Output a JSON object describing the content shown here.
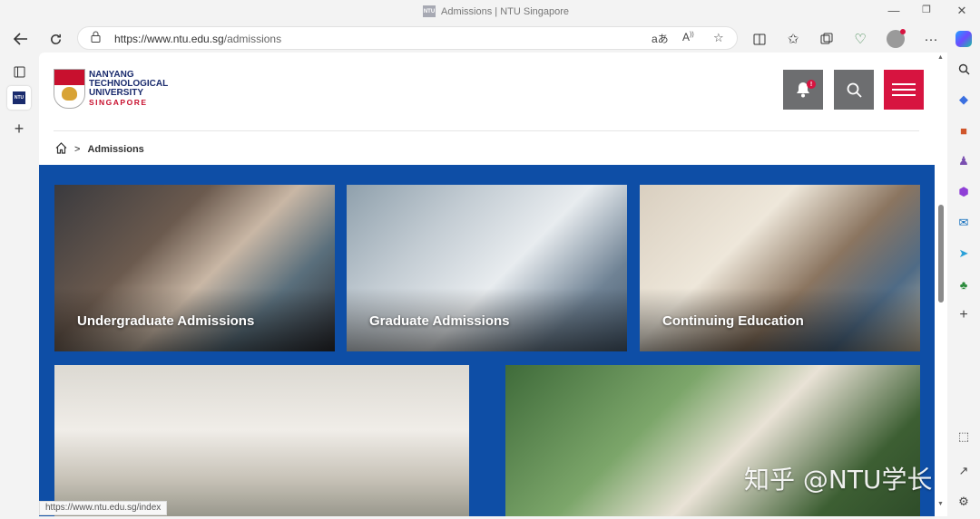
{
  "window": {
    "title": "Admissions | NTU Singapore",
    "favicon_label": "NTU",
    "controls": [
      "minimize-icon",
      "restore-icon",
      "close-icon"
    ]
  },
  "toolbar": {
    "icons": [
      "back-icon",
      "refresh-icon"
    ],
    "url_host": "https://www.ntu.edu.sg",
    "url_path": "/admissions",
    "right_icons": [
      "read-aloud-icon",
      "translate-icon",
      "favorite-star-icon",
      "split-screen-icon",
      "favorites-icon",
      "collections-icon",
      "browser-essentials-icon",
      "profile-avatar",
      "more-icon",
      "copilot-icon"
    ]
  },
  "vertical_tabs": {
    "tab_favicon": "NTU",
    "add_tab": "+"
  },
  "site": {
    "logo": {
      "line1": "NANYANG",
      "line2": "TECHNOLOGICAL",
      "line3": "UNIVERSITY",
      "line4": "SINGAPORE"
    },
    "notification_badge": "!",
    "breadcrumb": {
      "separator": ">",
      "current": "Admissions"
    },
    "cards": [
      {
        "label": "Undergraduate Admissions"
      },
      {
        "label": "Graduate Admissions"
      },
      {
        "label": "Continuing Education"
      },
      {
        "label": ""
      },
      {
        "label": ""
      }
    ],
    "brand_blue": "#0e4ea6",
    "brand_red": "#d71440"
  },
  "status_bar": {
    "url": "https://www.ntu.edu.sg/index"
  },
  "watermark": "知乎 @NTU学长"
}
